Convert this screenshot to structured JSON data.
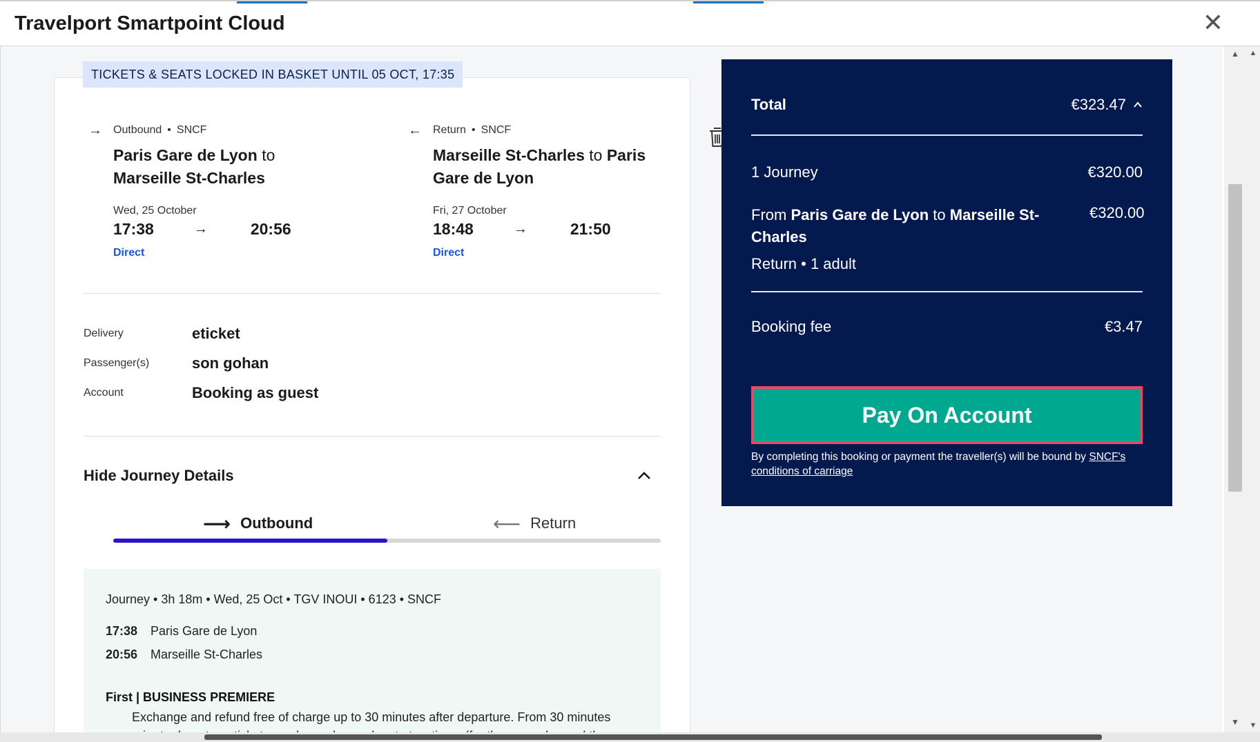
{
  "window": {
    "title": "Travelport Smartpoint Cloud"
  },
  "banner": {
    "text": "TICKETS & SEATS LOCKED IN BASKET UNTIL 05 OCT, 17:35"
  },
  "outbound": {
    "direction": "Outbound",
    "carrier": "SNCF",
    "origin": "Paris Gare de Lyon",
    "connector": "to",
    "destination": "Marseille St-Charles",
    "date": "Wed, 25 October",
    "depart": "17:38",
    "arrive": "20:56",
    "type": "Direct"
  },
  "return": {
    "direction": "Return",
    "carrier": "SNCF",
    "origin": "Marseille St-Charles",
    "connector": "to",
    "destination": "Paris Gare de Lyon",
    "date": "Fri, 27 October",
    "depart": "18:48",
    "arrive": "21:50",
    "type": "Direct"
  },
  "details": {
    "delivery_label": "Delivery",
    "delivery_value": "eticket",
    "passenger_label": "Passenger(s)",
    "passenger_value": "son gohan",
    "account_label": "Account",
    "account_value": "Booking as guest"
  },
  "journey_toggle": {
    "label": "Hide Journey Details"
  },
  "tabs": {
    "outbound_label": "Outbound",
    "return_label": "Return",
    "active": "Outbound"
  },
  "journey": {
    "summary": "Journey • 3h 18m • Wed, 25 Oct • TGV INOUI • 6123 • SNCF",
    "stops": [
      {
        "time": "17:38",
        "station": "Paris Gare de Lyon"
      },
      {
        "time": "20:56",
        "station": "Marseille St-Charles"
      }
    ],
    "fare_title": "First | BUSINESS PREMIERE",
    "fare_text": "Exchange and refund free of charge up to 30 minutes after departure. From 30 minutes prior to departure, tickets can be exchanged up to two times (for the same day and the"
  },
  "summary": {
    "total_label": "Total",
    "total_value": "€323.47",
    "journeys_label": "1 Journey",
    "journeys_value": "€320.00",
    "from_prefix": "From",
    "from_origin": "Paris Gare de Lyon",
    "from_connector": "to",
    "from_destination": "Marseille St-Charles",
    "from_value": "€320.00",
    "trip_info": "Return • 1 adult",
    "fee_label": "Booking fee",
    "fee_value": "€3.47",
    "pay_button": "Pay On Account",
    "terms_text": "By completing this booking or payment the traveller(s) will be bound by",
    "terms_link": "SNCF's conditions of carriage"
  },
  "colors": {
    "panel_bg": "#041a4e",
    "pay_button": "#00a88f",
    "pay_border": "#e8476a",
    "banner_bg": "#dbe5fb",
    "tab_active": "#2a12c7",
    "link_blue": "#1a56db",
    "journey_bg": "#eff8f4"
  }
}
